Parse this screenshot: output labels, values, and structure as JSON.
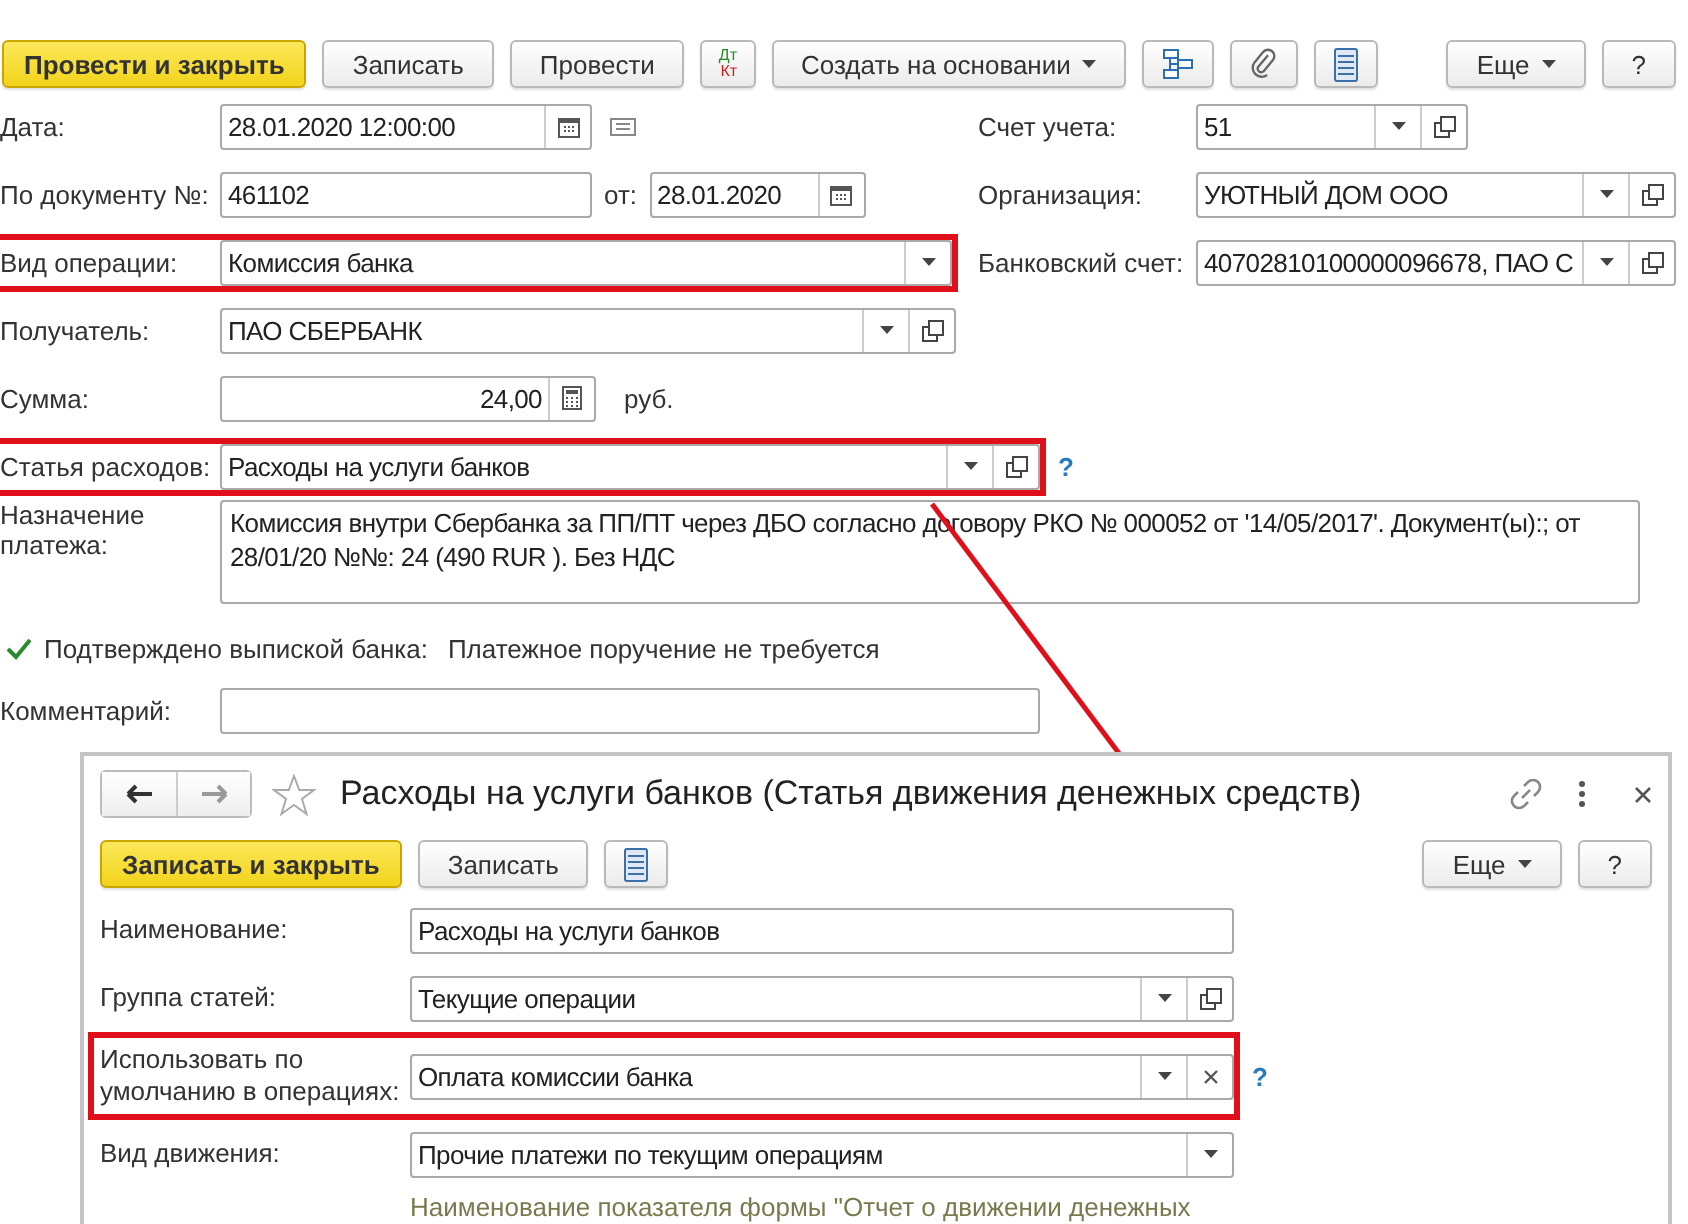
{
  "toolbar": [
    {
      "kind": "primary",
      "label": "Провести и закрыть"
    },
    {
      "kind": "plain",
      "label": "Записать"
    },
    {
      "kind": "plain",
      "label": "Провести"
    },
    {
      "kind": "dtkt",
      "top": "Дт",
      "bottom": "Кт"
    },
    {
      "kind": "menu",
      "label": "Создать на основании"
    },
    {
      "kind": "structure"
    },
    {
      "kind": "attach"
    },
    {
      "kind": "report"
    },
    {
      "kind": "menu",
      "label": "Еще"
    },
    {
      "kind": "plain",
      "label": "?"
    }
  ],
  "date": {
    "label": "Дата:",
    "value": "28.01.2020 12:00:00"
  },
  "account": {
    "label": "Счет учета:",
    "value": "51"
  },
  "doc_number": {
    "label": "По документу №:",
    "value": "461102"
  },
  "doc_date": {
    "label": "от:",
    "value": "28.01.2020"
  },
  "organization": {
    "label": "Организация:",
    "value": "УЮТНЫЙ ДОМ ООО"
  },
  "operation": {
    "label": "Вид операции:",
    "value": "Комиссия банка",
    "highlighted": true
  },
  "bank_account": {
    "label": "Банковский счет:",
    "value": "40702810100000096678, ПАО С"
  },
  "recipient": {
    "label": "Получатель:",
    "value": "ПАО СБЕРБАНК"
  },
  "amount": {
    "label": "Сумма:",
    "value": "24,00",
    "currency": "руб."
  },
  "expense_item": {
    "label": "Статья расходов:",
    "value": "Расходы на услуги банков",
    "highlighted": true,
    "help": "?"
  },
  "purpose": {
    "label": "Назначение платежа:",
    "value": "Комиссия внутри Сбербанка за ПП/ПТ через ДБО согласно договору РКО № 000052 от '14/05/2017'. Документ(ы):; от 28/01/20 №№: 24 (490 RUR  ). Без НДС"
  },
  "confirmed": {
    "label": "Подтверждено выпиской банка:",
    "checked": true,
    "note": "Платежное поручение не требуется"
  },
  "comment": {
    "label": "Комментарий:"
  },
  "catalog_window": {
    "title": "Расходы на услуги банков (Статья движения денежных средств)",
    "toolbar": [
      {
        "kind": "primary",
        "label": "Записать и закрыть"
      },
      {
        "kind": "plain",
        "label": "Записать"
      },
      {
        "kind": "report"
      },
      {
        "kind": "menu",
        "label": "Еще"
      },
      {
        "kind": "plain",
        "label": "?"
      }
    ],
    "name": {
      "label": "Наименование:",
      "value": "Расходы на услуги банков"
    },
    "group": {
      "label": "Группа статей:",
      "value": "Текущие операции"
    },
    "default_use": {
      "label": "Использовать по умолчанию в операциях:",
      "value": "Оплата комиссии банка",
      "highlighted": true,
      "help": "?"
    },
    "movement_kind": {
      "label": "Вид движения:",
      "value": "Прочие платежи по текущим операциям"
    },
    "hint": "Наименование показателя формы \"Отчет о движении денежных"
  }
}
